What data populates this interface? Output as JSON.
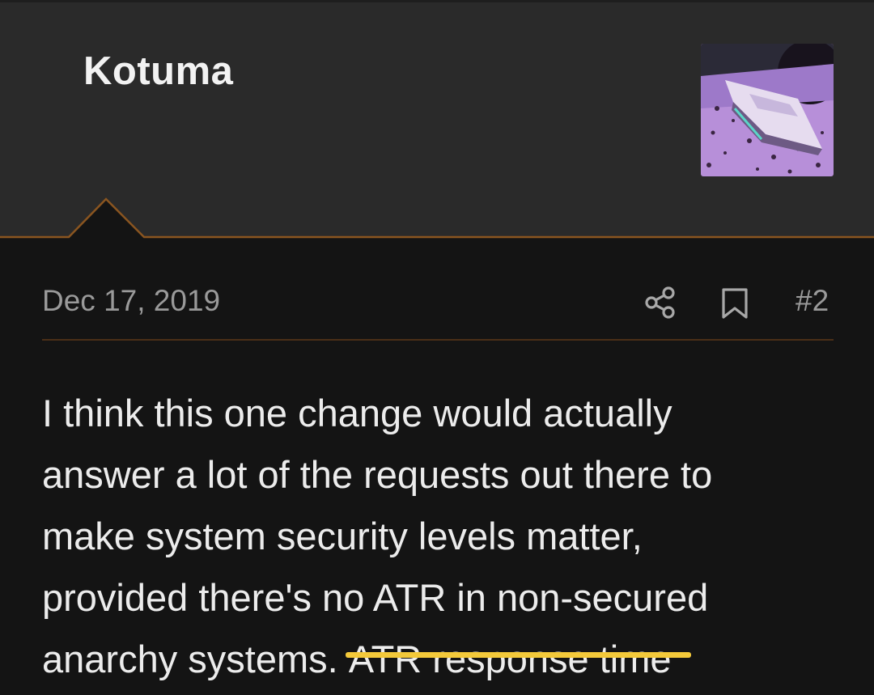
{
  "post": {
    "author": "Kotuma",
    "avatar_alt": "spaceship-avatar",
    "date": "Dec 17, 2019",
    "post_number": "#2",
    "body_lines": [
      "I think this one change would actually",
      "answer a lot of the requests out there to",
      "make system security levels matter,",
      "provided there's no ATR in non-secured"
    ],
    "last_line_prefix": "anarchy systems. ",
    "last_line_struck": "ATR response time"
  },
  "colors": {
    "header_bg": "#2a2a2a",
    "body_bg": "#141414",
    "accent_line": "#8a5520",
    "strike_highlight": "#f3c93a",
    "meta_text": "#9a9a9a"
  }
}
